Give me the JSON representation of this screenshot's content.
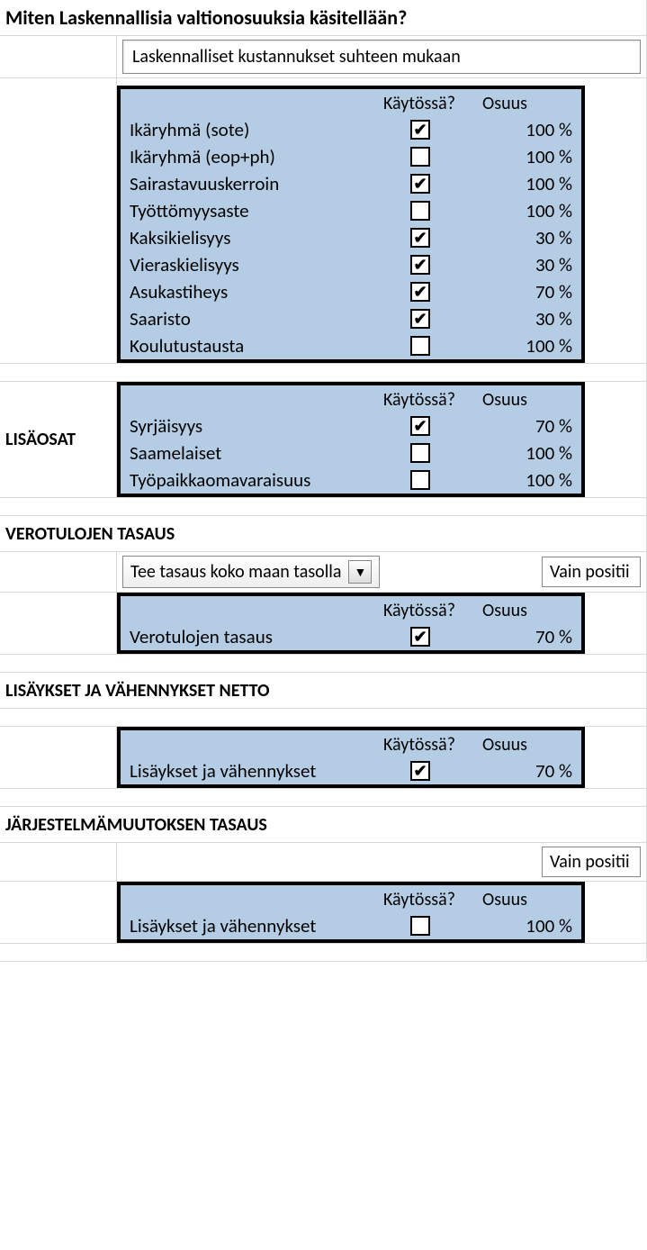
{
  "title": "Miten Laskennallisia valtionosuuksia käsitellään?",
  "input1": "Laskennalliset kustannukset suhteen mukaan",
  "headers": {
    "kaytossa": "Käytössä?",
    "osuus": "Osuus"
  },
  "panel1": {
    "rows": [
      {
        "label": "Ikäryhmä (sote)",
        "checked": true,
        "value": "100 %"
      },
      {
        "label": "Ikäryhmä (eop+ph)",
        "checked": false,
        "value": "100 %"
      },
      {
        "label": "Sairastavuuskerroin",
        "checked": true,
        "value": "100 %"
      },
      {
        "label": "Työttömyysaste",
        "checked": false,
        "value": "100 %"
      },
      {
        "label": "Kaksikielisyys",
        "checked": true,
        "value": "30 %"
      },
      {
        "label": "Vieraskielisyys",
        "checked": true,
        "value": "30 %"
      },
      {
        "label": "Asukastiheys",
        "checked": true,
        "value": "70 %"
      },
      {
        "label": "Saaristo",
        "checked": true,
        "value": "30 %"
      },
      {
        "label": "Koulutustausta",
        "checked": false,
        "value": "100 %"
      }
    ]
  },
  "section2": {
    "label": "LISÄOSAT"
  },
  "panel2": {
    "rows": [
      {
        "label": "Syrjäisyys",
        "checked": true,
        "value": "70 %"
      },
      {
        "label": "Saamelaiset",
        "checked": false,
        "value": "100 %"
      },
      {
        "label": "Työpaikkaomavaraisuus",
        "checked": false,
        "value": "100 %"
      }
    ]
  },
  "section3": {
    "label": "VEROTULOJEN TASAUS"
  },
  "dropdown3": "Tee tasaus koko maan tasolla",
  "trunc3": "Vain positii",
  "panel3": {
    "rows": [
      {
        "label": "Verotulojen tasaus",
        "checked": true,
        "value": "70 %"
      }
    ]
  },
  "section4": {
    "label": "LISÄYKSET JA VÄHENNYKSET NETTO"
  },
  "panel4": {
    "rows": [
      {
        "label": "Lisäykset ja vähennykset",
        "checked": true,
        "value": "70 %"
      }
    ]
  },
  "section5": {
    "label": "JÄRJESTELMÄMUUTOKSEN TASAUS"
  },
  "trunc5": "Vain positii",
  "panel5": {
    "rows": [
      {
        "label": "Lisäykset ja vähennykset",
        "checked": false,
        "value": "100 %"
      }
    ]
  }
}
